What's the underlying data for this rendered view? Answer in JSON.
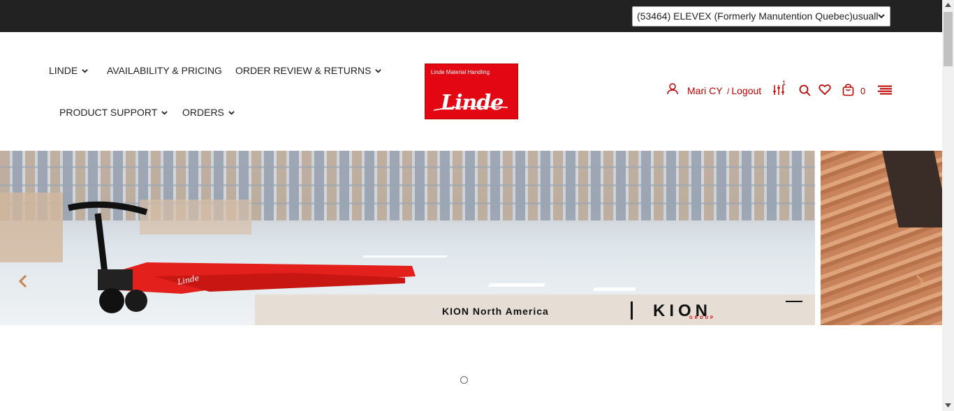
{
  "topbar": {
    "account_select": "(53464) ELEVEX (Formerly Manutention Quebec)usuall"
  },
  "nav": {
    "linde": "LINDE",
    "availability": "AVAILABILITY & PRICING",
    "order_review": "ORDER REVIEW & RETURNS",
    "product_support": "PRODUCT SUPPORT",
    "orders": "ORDERS"
  },
  "logo": {
    "tagline": "Linde Material Handling",
    "brand": "Linde"
  },
  "user": {
    "name": "Mari CY",
    "logout_sep": "/",
    "logout": "Logout",
    "compare_count": "1",
    "cart_count": "0"
  },
  "hero": {
    "banner_text": "KION North America",
    "kion_logo": "KION",
    "kion_group": "GROUP",
    "slides_count": 1,
    "active_slide": 1
  },
  "colors": {
    "brand_red": "#e30613",
    "topbar": "#222222",
    "link_red": "#bb0000"
  },
  "icons": [
    "chevron-down-icon",
    "user-icon",
    "compare-icon",
    "search-icon",
    "heart-icon",
    "cart-icon",
    "menu-icon",
    "arrow-left-icon",
    "arrow-right-icon"
  ]
}
